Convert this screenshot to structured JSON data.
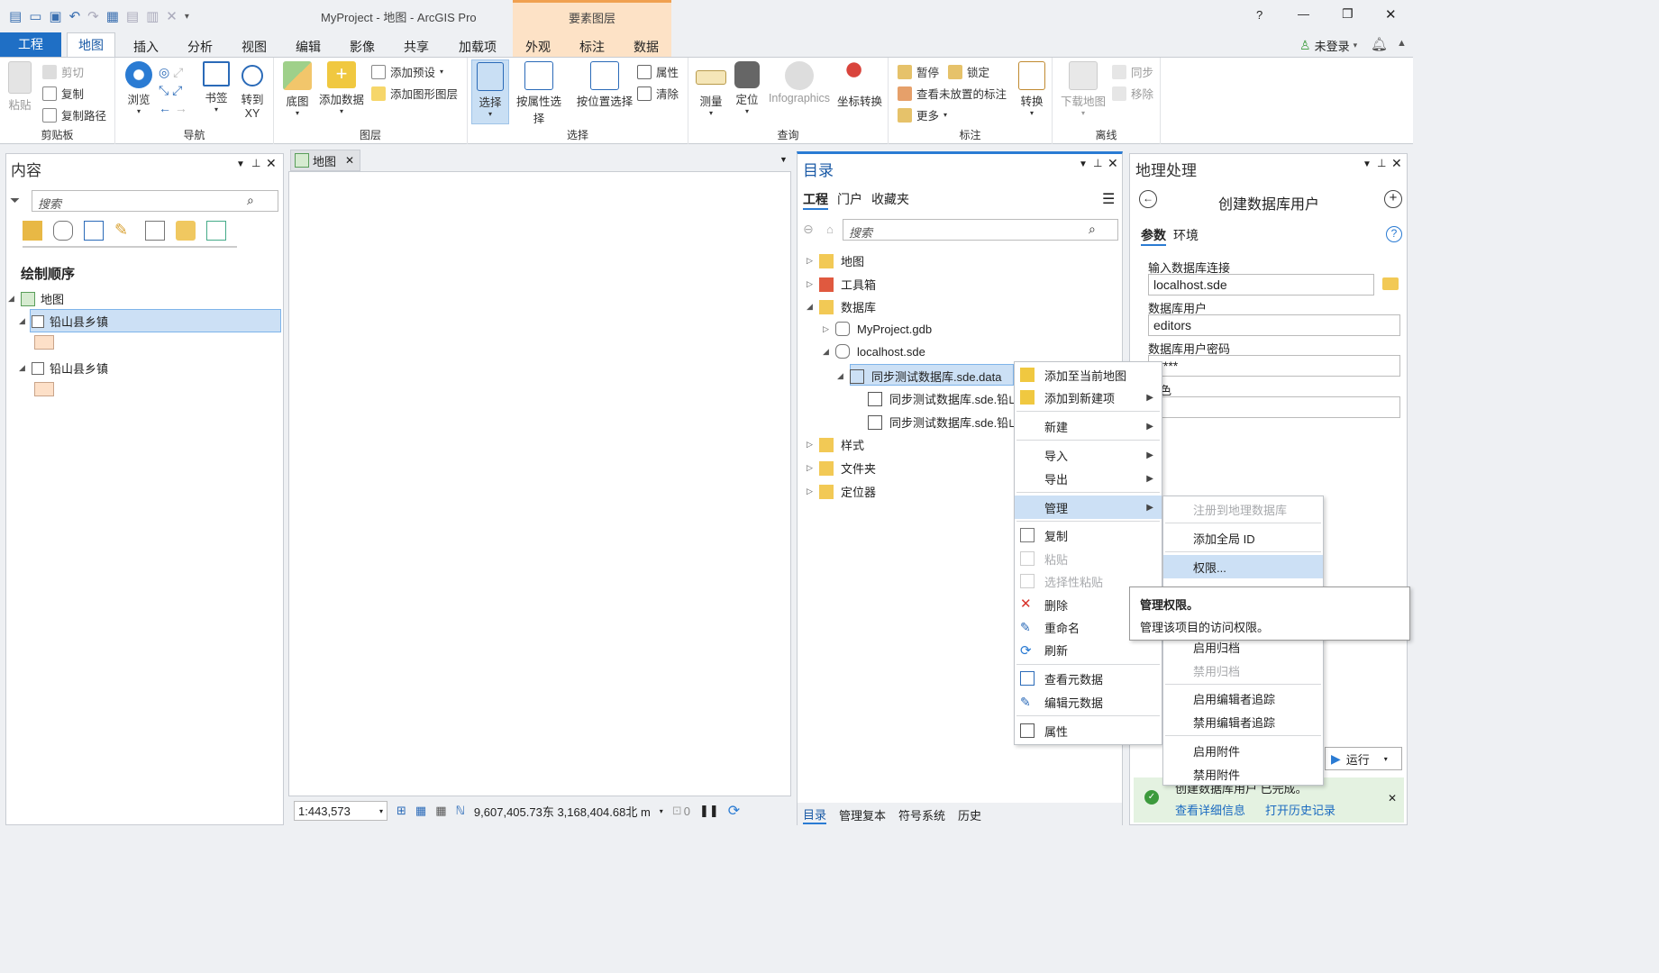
{
  "window": {
    "title": "MyProject - 地图 - ArcGIS Pro",
    "context_tab": "要素图层",
    "controls": {
      "help": "?",
      "min": "—",
      "max": "❐",
      "close": "✕"
    }
  },
  "ribbon_tabs": [
    "工程",
    "地图",
    "插入",
    "分析",
    "视图",
    "编辑",
    "影像",
    "共享",
    "加载项",
    "外观",
    "标注",
    "数据"
  ],
  "account": {
    "label": "未登录"
  },
  "ribbon": {
    "clipboard": {
      "paste": "粘贴",
      "cut": "剪切",
      "copy": "复制",
      "copy_path": "复制路径",
      "label": "剪贴板"
    },
    "nav": {
      "explore": "浏览",
      "bookmarks": "书签",
      "goto": "转到",
      "goto2": "XY",
      "label": "导航"
    },
    "layer": {
      "basemap": "底图",
      "add_data": "添加数据",
      "add_preset": "添加预设",
      "add_graphics": "添加图形图层",
      "label": "图层"
    },
    "selection": {
      "select": "选择",
      "by_attr": "按属性选择",
      "by_loc": "按位置选择",
      "attrs": "属性",
      "clear": "清除",
      "label": "选择"
    },
    "inquiry": {
      "measure": "测量",
      "locate": "定位",
      "infographics": "Infographics",
      "coord": "坐标转换",
      "label": "查询"
    },
    "labeling": {
      "pause": "暂停",
      "lock": "锁定",
      "unplaced": "查看未放置的标注",
      "more": "更多",
      "convert": "转换",
      "label": "标注"
    },
    "offline": {
      "download": "下载地图",
      "sync": "同步",
      "remove": "移除",
      "label": "离线"
    }
  },
  "contents": {
    "title": "内容",
    "search_placeholder": "搜索",
    "draw_order": "绘制顺序",
    "map": "地图",
    "layers": [
      "铅山县乡镇",
      "铅山县乡镇"
    ]
  },
  "map_view": {
    "tab": "地图",
    "scale": "1:443,573",
    "coords": "9,607,405.73东 3,168,404.68北 m",
    "sel_count": "0"
  },
  "catalog": {
    "title": "目录",
    "tabs": [
      "工程",
      "门户",
      "收藏夹"
    ],
    "search_placeholder": "搜索",
    "items": [
      "地图",
      "工具箱",
      "数据库",
      "MyProject.gdb",
      "localhost.sde",
      "同步测试数据库.sde.data",
      "同步测试数据库.sde.铅山",
      "同步测试数据库.sde.铅山",
      "样式",
      "文件夹",
      "定位器"
    ],
    "bottom_tabs": [
      "目录",
      "管理复本",
      "符号系统",
      "历史"
    ]
  },
  "context_menu": [
    "添加至当前地图",
    "添加到新建项",
    "新建",
    "导入",
    "导出",
    "管理",
    "复制",
    "粘贴",
    "选择性粘贴",
    "删除",
    "重命名",
    "刷新",
    "查看元数据",
    "编辑元数据",
    "属性"
  ],
  "submenu": [
    "注册到地理数据库",
    "添加全局 ID",
    "权限...",
    "启用归档",
    "禁用归档",
    "启用编辑者追踪",
    "禁用编辑者追踪",
    "启用附件",
    "禁用附件"
  ],
  "tooltip": {
    "title": "管理权限。",
    "body": "管理该项目的访问权限。"
  },
  "geoprocessing": {
    "title": "地理处理",
    "tool": "创建数据库用户",
    "tabs": [
      "参数",
      "环境"
    ],
    "fields": [
      {
        "label": "输入数据库连接",
        "value": "localhost.sde"
      },
      {
        "label": "数据库用户",
        "value": "editors"
      },
      {
        "label": "数据库用户密码",
        "value": "*****"
      },
      {
        "label": "角色",
        "value": ""
      }
    ],
    "run": "运行",
    "status": "创建数据库用户 已完成。",
    "details": "查看详细信息",
    "history": "打开历史记录"
  }
}
